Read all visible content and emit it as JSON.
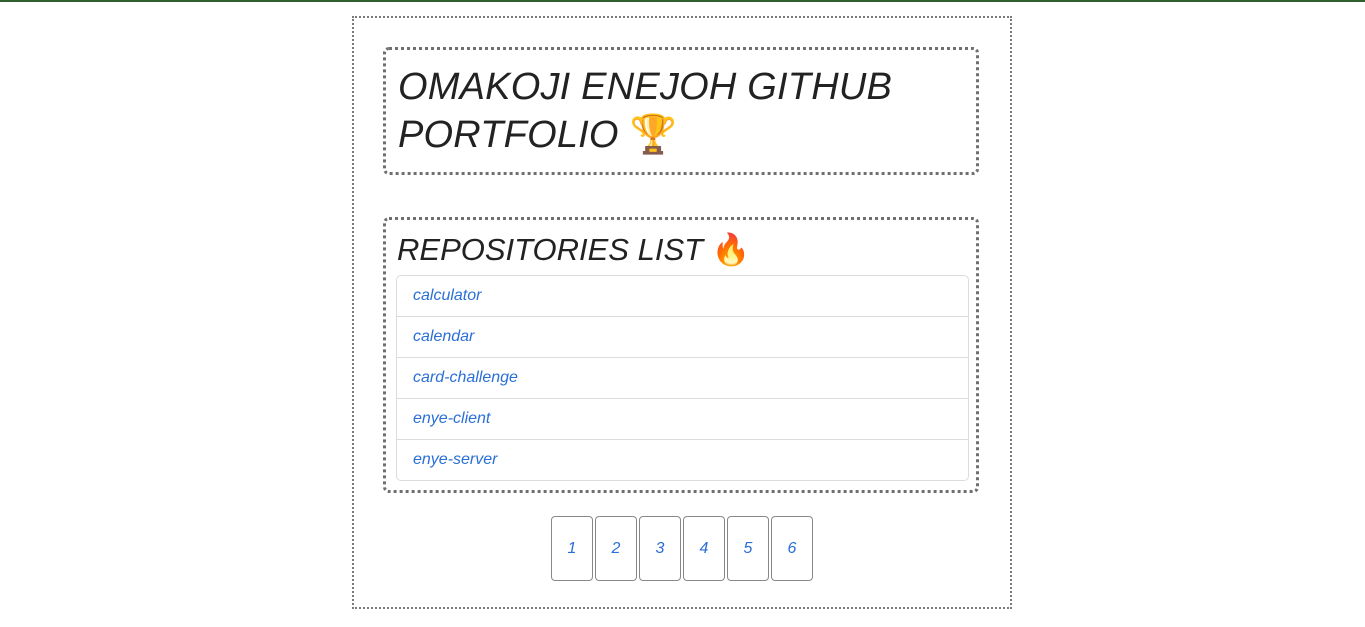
{
  "header": {
    "title": "OMAKOJI ENEJOH GITHUB PORTFOLIO",
    "title_emoji": "🏆"
  },
  "repositories": {
    "heading": "REPOSITORIES LIST",
    "heading_emoji": "🔥",
    "items": [
      {
        "label": "calculator"
      },
      {
        "label": "calendar"
      },
      {
        "label": "card-challenge"
      },
      {
        "label": "enye-client"
      },
      {
        "label": "enye-server"
      }
    ]
  },
  "pagination": {
    "pages": [
      "1",
      "2",
      "3",
      "4",
      "5",
      "6"
    ]
  },
  "colors": {
    "top_bar": "#2f5f2f",
    "link": "#2a6fd6",
    "text": "#222222"
  }
}
